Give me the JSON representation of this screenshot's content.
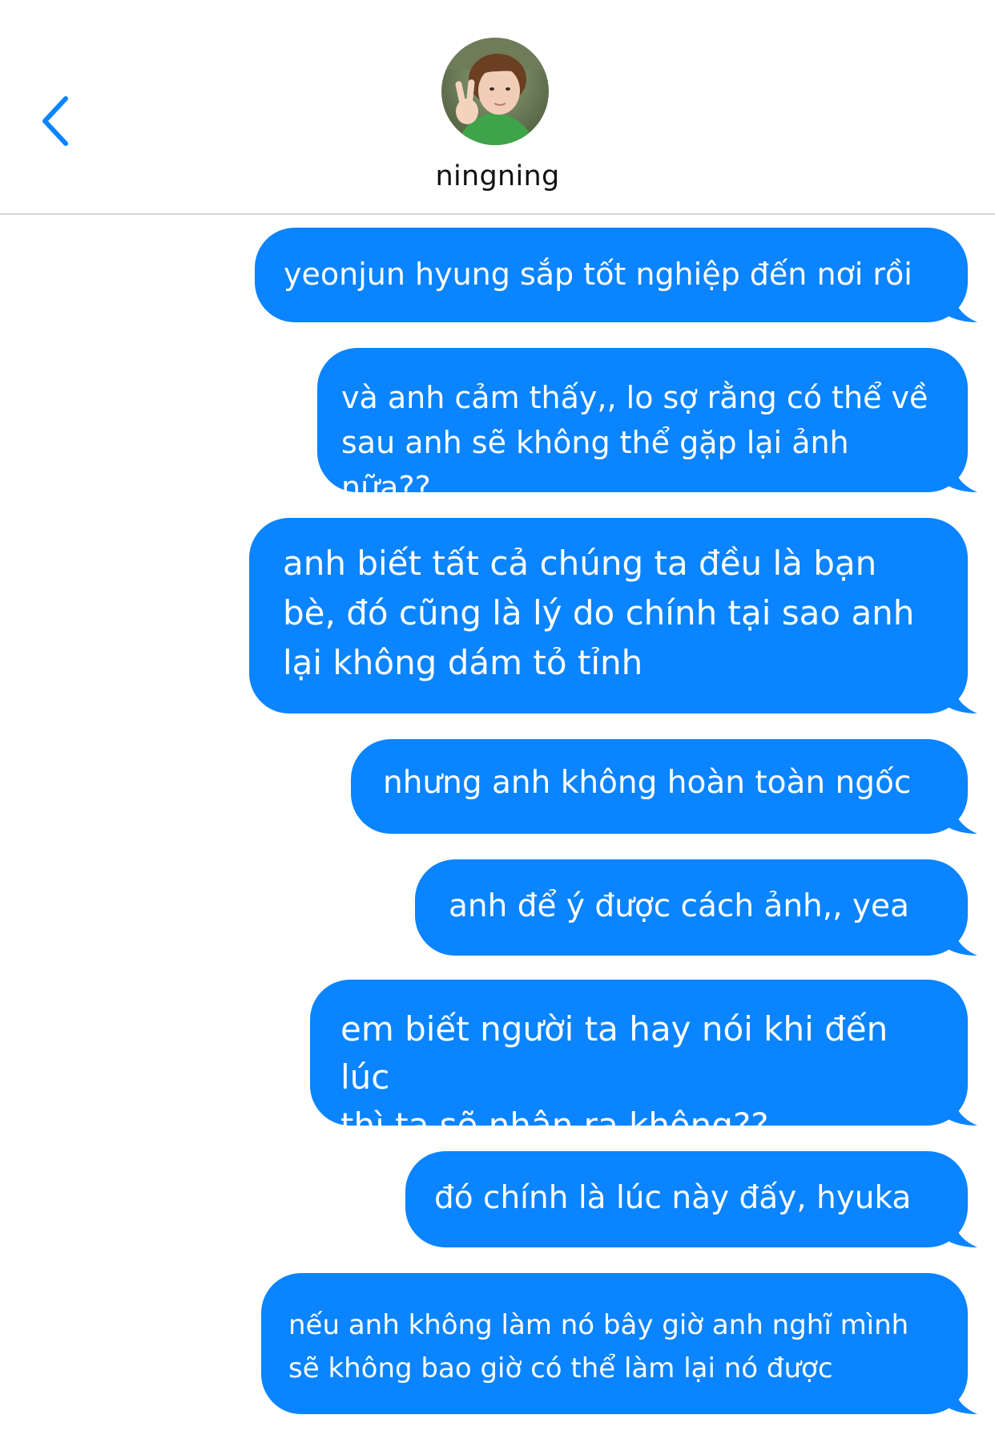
{
  "header": {
    "contact_name": "ningning",
    "back_icon": "chevron-left-icon",
    "accent_color": "#0a84ff"
  },
  "messages": [
    {
      "sender": "me",
      "text": "yeonjun hyung sắp tốt nghiệp đến nơi rồi"
    },
    {
      "sender": "me",
      "text": "và anh cảm thấy,, lo sợ rằng có thể về\nsau anh sẽ không thể gặp lại ảnh nữa??"
    },
    {
      "sender": "me",
      "text": "anh biết tất cả chúng ta đều là bạn\nbè, đó cũng là lý do chính tại sao anh\nlại không dám tỏ tỉnh"
    },
    {
      "sender": "me",
      "text": "nhưng anh không hoàn toàn ngốc"
    },
    {
      "sender": "me",
      "text": "anh để ý được cách ảnh,, yea"
    },
    {
      "sender": "me",
      "text": "em biết người ta hay nói khi đến lúc\nthì ta sẽ nhận ra không??"
    },
    {
      "sender": "me",
      "text": "đó chính là lúc này đấy, hyuka"
    },
    {
      "sender": "me",
      "text": "nếu anh không làm nó bây giờ anh nghĩ mình\nsẽ không bao giờ có thể làm lại nó được"
    }
  ]
}
